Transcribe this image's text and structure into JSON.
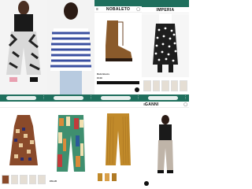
{
  "tiles": {
    "t1": {
      "kind": "model photo"
    },
    "t2": {
      "kind": "model photo"
    },
    "t3": {
      "brand": "NOBALETO",
      "product_name": "Rubi Boots",
      "price": "€149"
    },
    "t4": {
      "brand": "IMPERIA"
    },
    "t5": {},
    "t6": {
      "price": "€59.95"
    },
    "t7": {},
    "t8": {
      "brand": "GANNI"
    }
  },
  "colors": {
    "chrome_teal": "#1f6f5d",
    "zebra_dark": "#222222",
    "stripe_blue": "#3a4fa0",
    "boot_brown": "#8a5a2b",
    "mustard": "#c18a2a",
    "patchwork_green": "#3f8f6f"
  }
}
